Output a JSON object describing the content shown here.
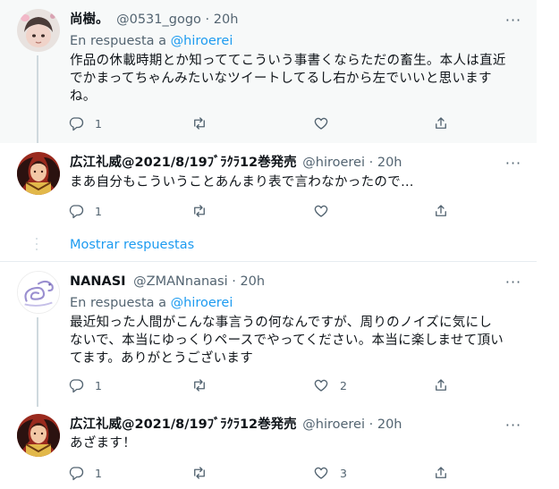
{
  "tweets": [
    {
      "name": "尚樹。",
      "handle": "@0531_gogo",
      "dot": "·",
      "time": "20h",
      "reply_prefix": "En respuesta a",
      "reply_handle": "@hiroerei",
      "lines": [
        "作品の休載時期とか知っててこういう事書くならただの畜生。本人は直近",
        "でかまってちゃんみたいなツイートしてるし右から左でいいと思います",
        "ね。"
      ],
      "reply_count": "1",
      "retweet_count": "",
      "like_count": ""
    },
    {
      "name": "広江礼威@2021/8/19ﾌﾞﾗｸﾗ12巻発売",
      "handle": "@hiroerei",
      "dot": "·",
      "time": "20h",
      "lines": [
        "まあ自分もこういうことあんまり表で言わなかったので…"
      ],
      "reply_count": "1",
      "retweet_count": "",
      "like_count": ""
    },
    {
      "name": "NANASI",
      "handle": "@ZMANnanasi",
      "dot": "·",
      "time": "20h",
      "reply_prefix": "En respuesta a",
      "reply_handle": "@hiroerei",
      "lines": [
        "最近知った人間がこんな事言うの何なんですが、周りのノイズに気にし",
        "ないで、本当にゆっくりペースでやってください。本当に楽しませて頂い",
        "てます。ありがとうございます"
      ],
      "reply_count": "1",
      "retweet_count": "",
      "like_count": "2"
    },
    {
      "name": "広江礼威@2021/8/19ﾌﾞﾗｸﾗ12巻発売",
      "handle": "@hiroerei",
      "dot": "·",
      "time": "20h",
      "lines": [
        "あざます！"
      ],
      "reply_count": "1",
      "retweet_count": "",
      "like_count": "3"
    }
  ],
  "show_replies_label": "Mostrar respuestas",
  "more_glyph": "···",
  "icons": [
    "reply-icon",
    "retweet-icon",
    "like-icon",
    "share-icon",
    "more-icon"
  ],
  "colors": {
    "link": "#1d9bf0",
    "muted": "#536471",
    "highlight_bg": "#f7f9f9",
    "border": "#e6ecf0"
  }
}
